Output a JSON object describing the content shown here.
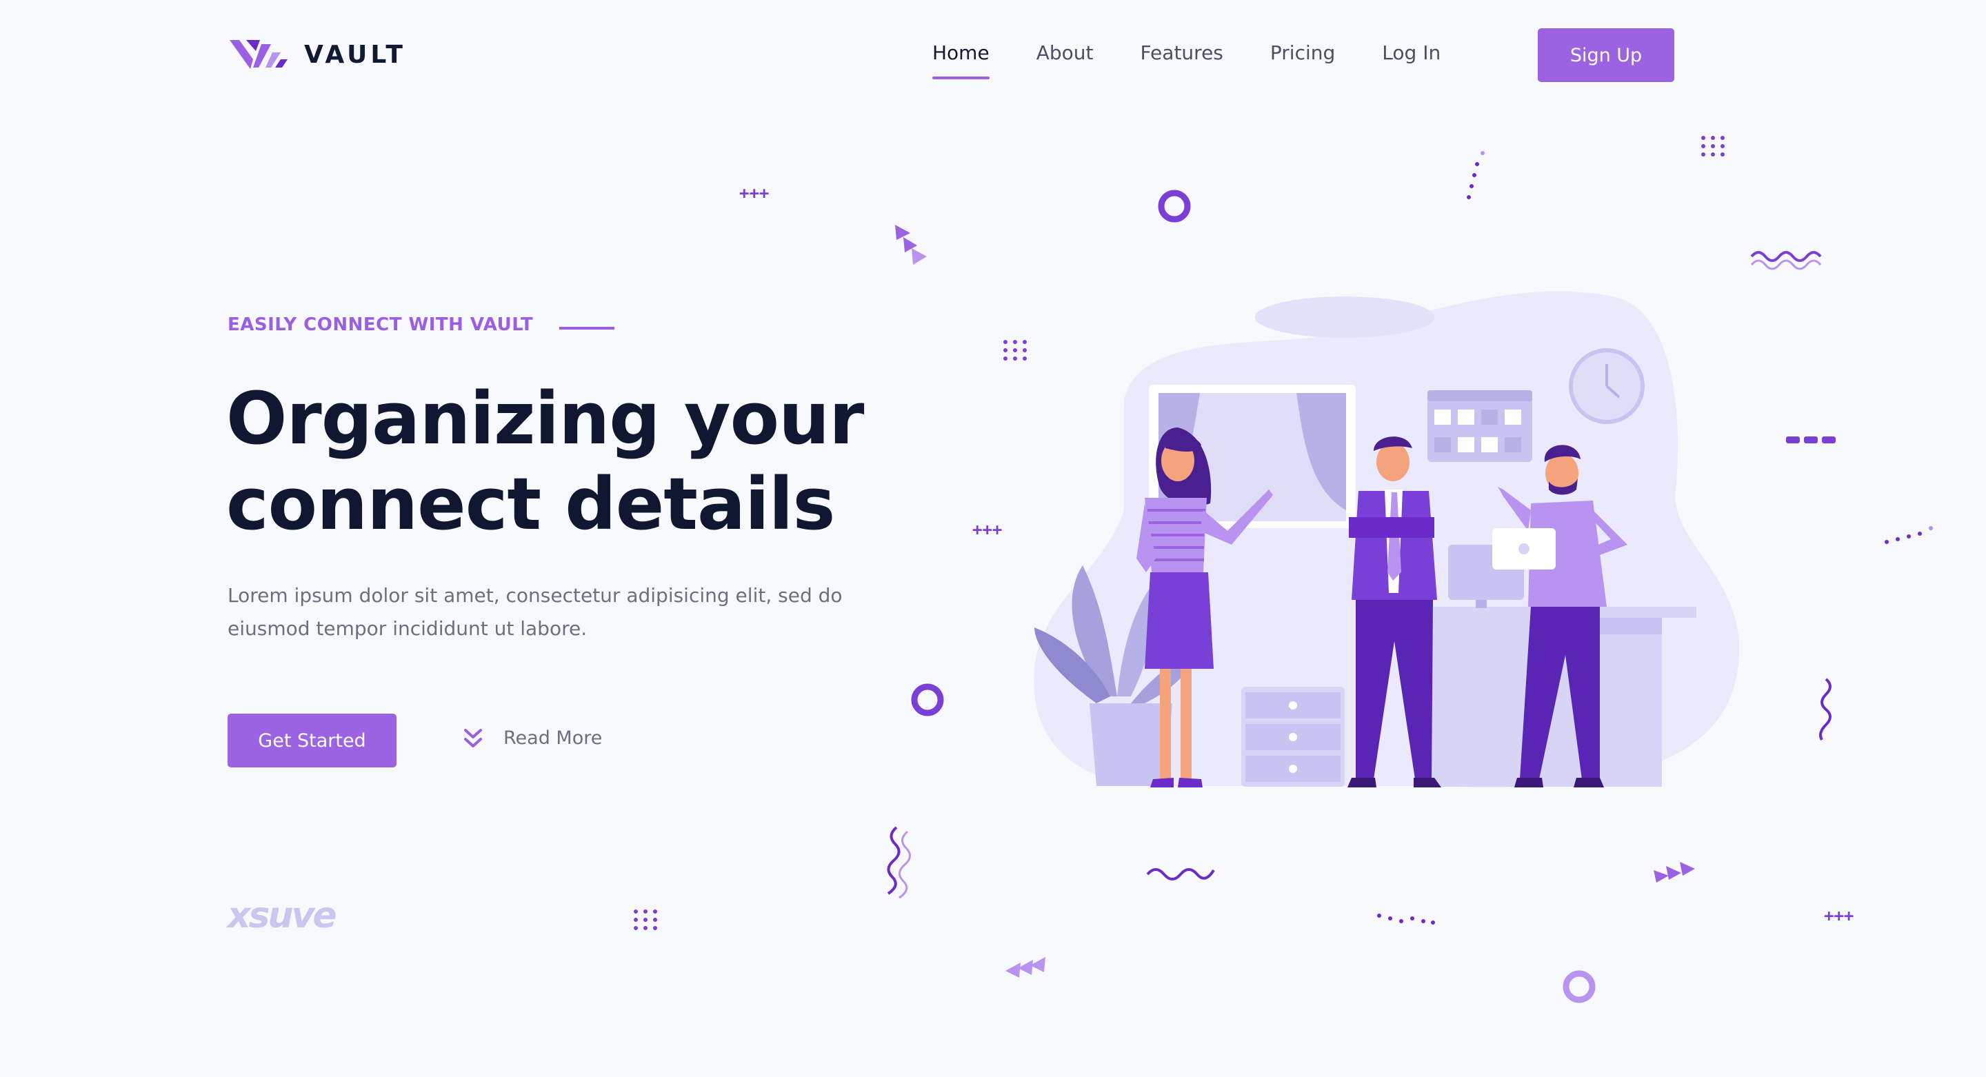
{
  "brand": {
    "name": "VAULT"
  },
  "nav": {
    "items": [
      {
        "label": "Home",
        "active": true
      },
      {
        "label": "About",
        "active": false
      },
      {
        "label": "Features",
        "active": false
      },
      {
        "label": "Pricing",
        "active": false
      },
      {
        "label": "Log In",
        "active": false
      }
    ],
    "signup_label": "Sign Up"
  },
  "hero": {
    "eyebrow": "EASILY CONNECT WITH VAULT",
    "title_line1": "Organizing your",
    "title_line2": "connect details",
    "description_line1": "Lorem ipsum dolor sit amet, consectetur adipisicing elit, sed do",
    "description_line2": "eiusmod tempor incididunt ut labore.",
    "cta_label": "Get Started",
    "read_more_label": "Read More"
  },
  "watermark": "xsuve",
  "colors": {
    "accent": "#9b63e2",
    "accent_dark": "#6a2bc9",
    "text_dark": "#101731",
    "text_muted": "#6b6f80",
    "illustration_bg": "#ebeafc"
  },
  "icons": {
    "logo": "vault-chevron-logo-icon",
    "read_more": "double-chevron-down-icon"
  }
}
